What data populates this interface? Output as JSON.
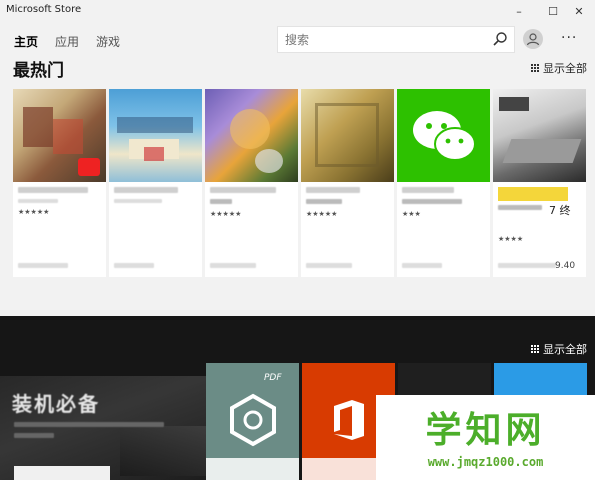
{
  "window": {
    "title": "Microsoft Store",
    "minimize_glyph": "–",
    "maximize_glyph": "☐",
    "close_glyph": "✕"
  },
  "nav": {
    "tabs": [
      {
        "label": "主页",
        "active": true
      },
      {
        "label": "应用",
        "active": false
      },
      {
        "label": "游戏",
        "active": false
      }
    ],
    "search_placeholder": "搜索",
    "more_glyph": "···"
  },
  "top_section": {
    "title": "最热门",
    "show_all": "显示全部",
    "cards": [
      {
        "icon": "game-thumbnail",
        "stars": "★★★★★",
        "colors": [
          "#8b5a3c",
          "#c24b36",
          "#e2d2b2"
        ]
      },
      {
        "icon": "game-thumbnail",
        "stars": "",
        "colors": [
          "#5aa7d8",
          "#f0e6c8",
          "#3c6fa0"
        ]
      },
      {
        "icon": "game-thumbnail",
        "stars": "★★★★★",
        "colors": [
          "#7a6bc1",
          "#f0b13c",
          "#5c7f38"
        ]
      },
      {
        "icon": "game-thumbnail",
        "stars": "★★★★★",
        "colors": [
          "#bfa052",
          "#6b5a2c",
          "#e6d8a0"
        ]
      },
      {
        "icon": "wechat-icon",
        "stars": "★★★",
        "colors": [
          "#2dc100",
          "#ffffff",
          "#2dc100"
        ]
      },
      {
        "icon": "game-thumbnail",
        "stars": "★★★★",
        "colors": [
          "#d8d8d8",
          "#555555",
          "#e8c85a"
        ]
      }
    ],
    "last_card_badge": "7 终",
    "last_card_price": "9.40"
  },
  "featured_section": {
    "show_all": "显示全部",
    "banner_title": "装机必备",
    "tiles": [
      {
        "icon": "hexagon-nut-icon",
        "bg": "#6b8c86",
        "label": "PDF"
      },
      {
        "icon": "office-icon",
        "bg": "#d83b01",
        "label": ""
      },
      {
        "icon": "ring-icon",
        "bg": "#1f1f1f",
        "label": ""
      },
      {
        "icon": "whatsapp-icon",
        "bg": "#2b9be6",
        "label": ""
      }
    ]
  },
  "watermark": {
    "title": "学知网",
    "url": "www.jmqz1000.com"
  }
}
